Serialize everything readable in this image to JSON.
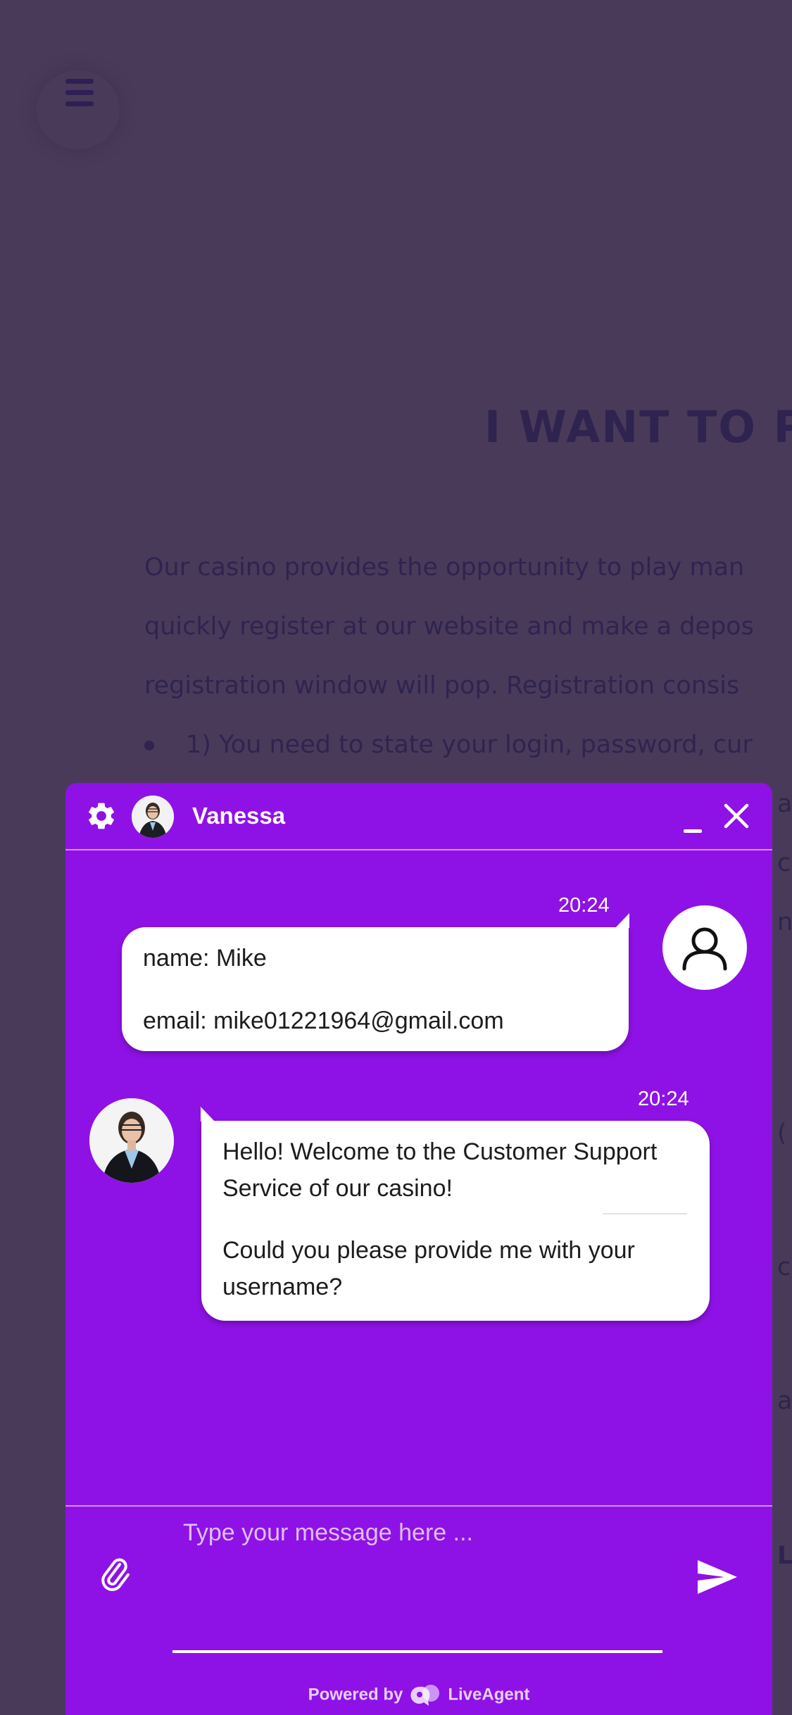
{
  "background": {
    "title": "I WANT TO PL",
    "paragraph_lines": [
      "Our casino provides the opportunity to play man",
      "quickly register at our website and make a depos",
      "registration window will pop. Registration consis"
    ],
    "bullet_text": "1) You need to state your login, password, cur",
    "edge_fragments": [
      "a",
      "c",
      "n",
      "(",
      "c",
      "a",
      "L"
    ]
  },
  "chat": {
    "agent_name": "Vanessa",
    "messages": [
      {
        "sender": "user",
        "time": "20:24",
        "lines": [
          "name:  Mike",
          "email: mike01221964@gmail.com"
        ]
      },
      {
        "sender": "agent",
        "time": "20:24",
        "lines": [
          "Hello! Welcome to the Customer Support",
          "Service of our casino!",
          "Could you please provide me with your",
          "username?"
        ]
      }
    ],
    "input": {
      "placeholder": "Type your message here ...",
      "value": ""
    },
    "footer": {
      "powered_by": "Powered by",
      "brand": "LiveAgent"
    },
    "icons": {
      "settings": "gear-icon",
      "minimize": "minimize-icon",
      "close": "close-icon",
      "attach": "paperclip-icon",
      "send": "send-icon",
      "user_avatar": "user-icon"
    },
    "colors": {
      "widget": "#8e12e6",
      "overlay": "#4a3a5a",
      "bubble": "#ffffff"
    }
  }
}
